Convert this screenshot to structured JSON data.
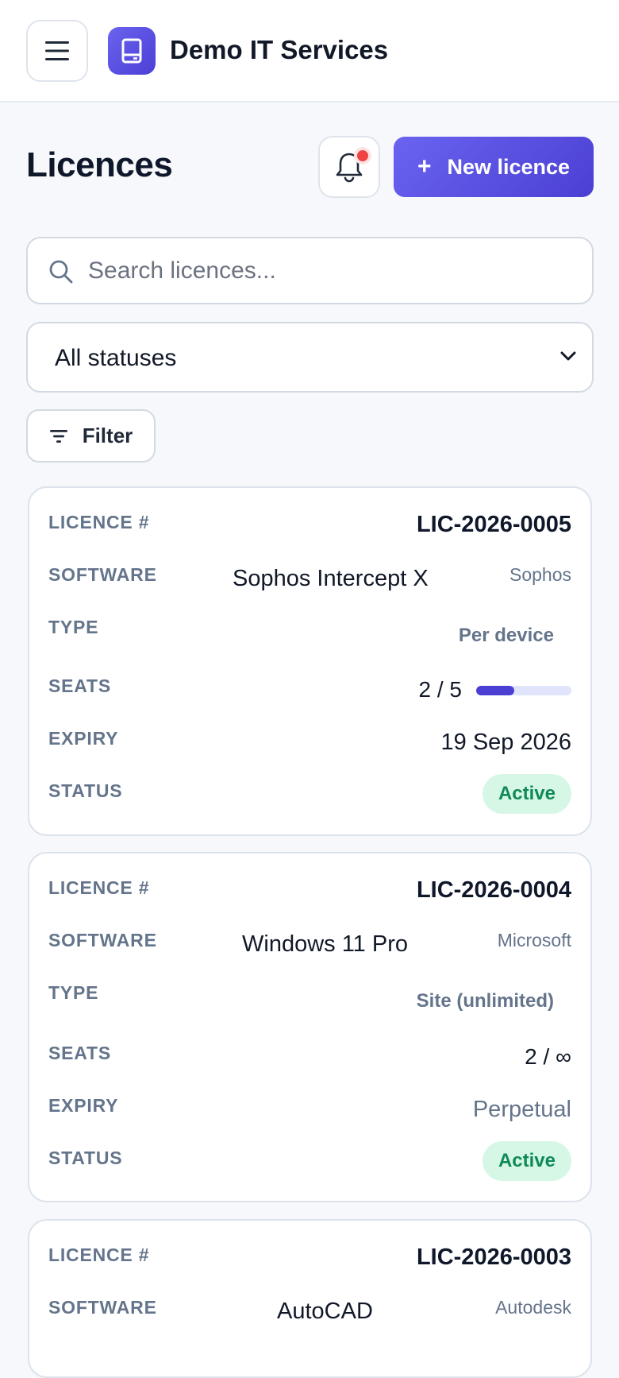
{
  "app": {
    "name": "Demo IT Services",
    "brand_color": "#5b53e6"
  },
  "header": {
    "title": "Licences",
    "new_button_label": "New licence",
    "new_button_icon": "plus-icon",
    "notification_icon": "bell-icon",
    "has_unread_notifications": true
  },
  "search": {
    "placeholder": "Search licences...",
    "value": ""
  },
  "status_filter": {
    "selected": "All statuses"
  },
  "filter_button": {
    "label": "Filter"
  },
  "labels": {
    "licence_num": "LICENCE #",
    "software": "SOFTWARE",
    "type": "TYPE",
    "seats": "SEATS",
    "expiry": "EXPIRY",
    "status": "STATUS"
  },
  "licences": [
    {
      "number": "LIC-2026-0005",
      "software": "Sophos Intercept X",
      "vendor": "Sophos",
      "type": "Per device",
      "seats": "2 / 5",
      "seats_used_fraction": 0.4,
      "expiry": "19 Sep 2026",
      "status": "Active"
    },
    {
      "number": "LIC-2026-0004",
      "software": "Windows 11 Pro",
      "vendor": "Microsoft",
      "type": "Site (unlimited)",
      "seats": "2 / ∞",
      "expiry": "Perpetual",
      "status": "Active"
    },
    {
      "number": "LIC-2026-0003",
      "software": "AutoCAD",
      "vendor": "Autodesk"
    }
  ],
  "colors": {
    "status_active_bg": "#d7f7e6",
    "status_active_text": "#0f8a55",
    "seat_bar_fill": "#4b3fd3",
    "seat_bar_track": "#e0e5fb"
  }
}
